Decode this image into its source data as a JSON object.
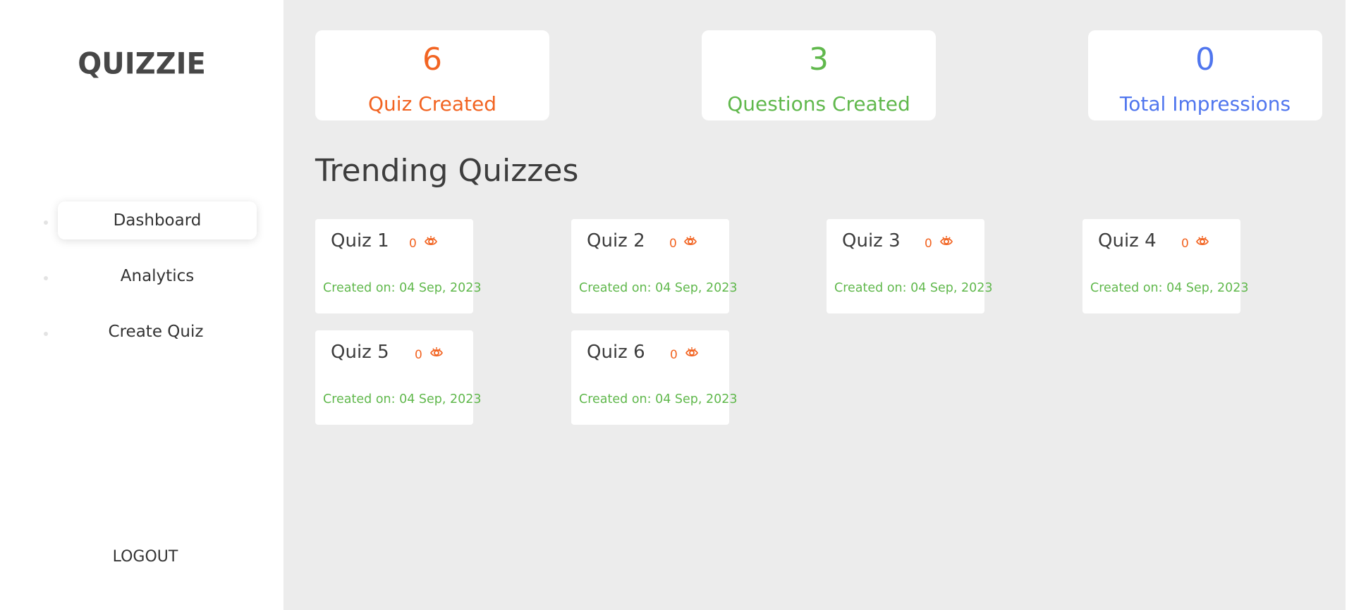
{
  "brand": "QUIZZIE",
  "sidebar": {
    "items": [
      {
        "label": "Dashboard",
        "active": true
      },
      {
        "label": "Analytics",
        "active": false
      },
      {
        "label": "Create Quiz",
        "active": false
      }
    ],
    "logout_label": "LOGOUT"
  },
  "stats": [
    {
      "value": "6",
      "label": "Quiz Created",
      "color": "#f26422"
    },
    {
      "value": "3",
      "label": "Questions Created",
      "color": "#60b84c"
    },
    {
      "value": "0",
      "label": "Total Impressions",
      "color": "#5076ee"
    }
  ],
  "trending": {
    "title": "Trending Quizzes",
    "quizzes": [
      {
        "name": "Quiz 1",
        "views": "0",
        "created": "Created on: 04 Sep, 2023"
      },
      {
        "name": "Quiz 2",
        "views": "0",
        "created": "Created on: 04 Sep, 2023"
      },
      {
        "name": "Quiz 3",
        "views": "0",
        "created": "Created on: 04 Sep, 2023"
      },
      {
        "name": "Quiz 4",
        "views": "0",
        "created": "Created on: 04 Sep, 2023"
      },
      {
        "name": "Quiz 5",
        "views": "0",
        "created": "Created on: 04 Sep, 2023"
      },
      {
        "name": "Quiz 6",
        "views": "0",
        "created": "Created on: 04 Sep, 2023"
      }
    ],
    "eye_icon": "eye-icon",
    "views_color": "#f26422",
    "date_color": "#60b84c"
  }
}
